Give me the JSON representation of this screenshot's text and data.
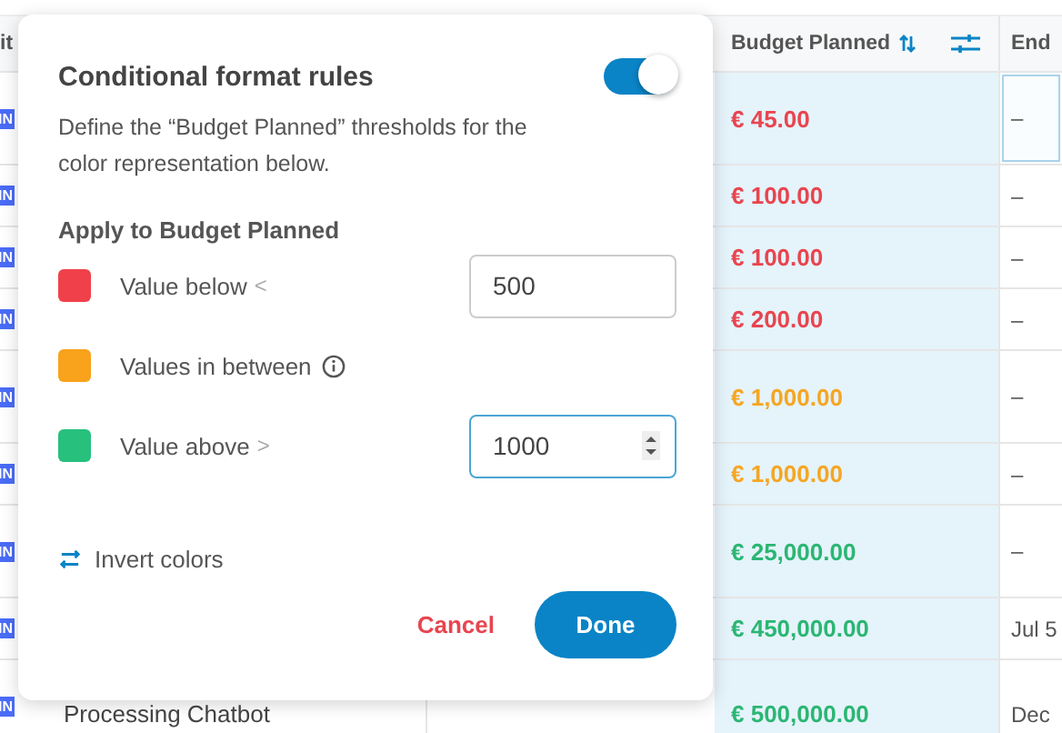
{
  "table": {
    "columns": [
      {
        "label": "it"
      },
      {
        "label": "Budget Planned"
      },
      {
        "label": "End"
      }
    ],
    "rows": [
      {
        "badge": "IN",
        "budget": "€ 45.00",
        "color": "#e8454f",
        "end": "–",
        "end_selected": true
      },
      {
        "badge": "IN",
        "budget": "€ 100.00",
        "color": "#e8454f",
        "end": "–",
        "end_selected": false
      },
      {
        "badge": "IN",
        "budget": "€ 100.00",
        "color": "#e8454f",
        "end": "–",
        "end_selected": false
      },
      {
        "badge": "IN",
        "budget": "€ 200.00",
        "color": "#e8454f",
        "end": "–",
        "end_selected": false
      },
      {
        "badge": "IN",
        "budget": "€ 1,000.00",
        "color": "#f5a623",
        "end": "–",
        "end_selected": false
      },
      {
        "badge": "IN",
        "budget": "€ 1,000.00",
        "color": "#f5a623",
        "end": "–",
        "end_selected": false
      },
      {
        "badge": "IN",
        "budget": "€ 25,000.00",
        "color": "#2bb673",
        "end": "–",
        "end_selected": false
      },
      {
        "badge": "IN",
        "budget": "€ 450,000.00",
        "color": "#2bb673",
        "end": "Jul 5",
        "end_selected": false
      },
      {
        "badge": "IN",
        "name": "Processing Chatbot",
        "budget": "€ 500,000.00",
        "color": "#2bb673",
        "end": "Dec",
        "end_selected": false
      }
    ]
  },
  "dialog": {
    "title": "Conditional format rules",
    "enabled": true,
    "description": "Define the “Budget Planned” thresholds for the color representation below.",
    "section": "Apply to Budget Planned",
    "rules": [
      {
        "kind": "input",
        "label": "Value below",
        "symbol": "<",
        "color": "#f0414b",
        "value": "500",
        "focused": false
      },
      {
        "kind": "info",
        "label": "Values in between",
        "color": "#f9a21b"
      },
      {
        "kind": "input",
        "label": "Value above",
        "symbol": ">",
        "color": "#27c07d",
        "value": "1000",
        "focused": true
      }
    ],
    "invert": "Invert colors",
    "cancel": "Cancel",
    "done": "Done"
  }
}
